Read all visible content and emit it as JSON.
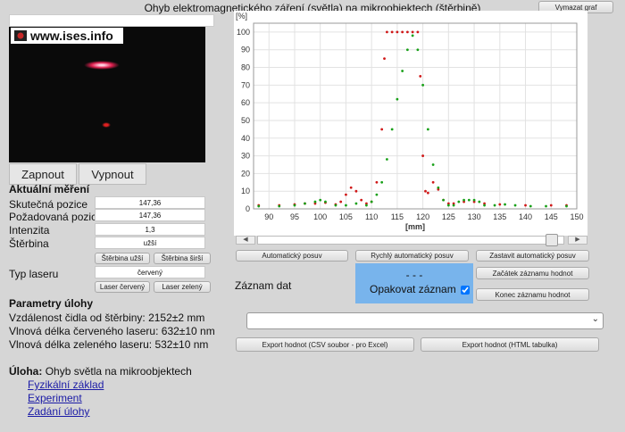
{
  "title": "Ohyb elektromagnetického záření (světla) na mikroobjektech (štěrbině)",
  "clear_graph": "Vymazat graf",
  "camera": {
    "logo": "www.ises.info"
  },
  "buttons": {
    "on": "Zapnout",
    "off": "Vypnout"
  },
  "measure": {
    "heading": "Aktuální měření",
    "actual_pos_label": "Skutečná pozice",
    "actual_pos": "147,36",
    "target_pos_label": "Požadovaná pozice",
    "target_pos": "147,36",
    "intensity_label": "Intenzita",
    "intensity": "1,3",
    "slit_label": "Štěrbina",
    "slit": "užší",
    "slit_narrower": "Štěrbina užší",
    "slit_wider": "Štěrbina širší",
    "laser_type_label": "Typ laseru",
    "laser_type": "červený",
    "laser_red": "Laser červený",
    "laser_green": "Laser zelený"
  },
  "params": {
    "heading": "Parametry úlohy",
    "distance": "Vzdálenost čidla od štěrbiny: 2152±2 mm",
    "red_wavelength": "Vlnová délka červeného laseru: 632±10 nm",
    "green_wavelength": "Vlnová délka zeleného laseru: 532±10 nm"
  },
  "task": {
    "label": "Úloha:",
    "name": "Ohyb světla na mikroobjektech",
    "links": [
      "Fyzikální základ",
      "Experiment",
      "Zadání úlohy"
    ]
  },
  "controls": {
    "auto_move": "Automatický posuv",
    "fast_auto_move": "Rychlý automatický posuv",
    "stop_auto_move": "Zastavit automatický posuv",
    "record_label": "Záznam dat",
    "record_status": "- - -",
    "repeat_record": "Opakovat záznam",
    "start_record": "Začátek záznamu hodnot",
    "end_record": "Konec záznamu hodnot",
    "export_csv": "Export hodnot (CSV soubor - pro Excel)",
    "export_html": "Export hodnot (HTML tabulka)"
  },
  "chart_data": {
    "type": "scatter",
    "ylabel": "[%]",
    "xlabel": "[mm]",
    "xlim": [
      87,
      150
    ],
    "ylim": [
      0,
      105
    ],
    "xticks": [
      90,
      95,
      100,
      105,
      110,
      115,
      120,
      125,
      130,
      135,
      140,
      145,
      150
    ],
    "yticks": [
      0,
      10,
      20,
      30,
      40,
      50,
      60,
      70,
      80,
      90,
      100
    ],
    "grid": true,
    "series": [
      {
        "color": "#d01818",
        "points": [
          [
            88,
            2
          ],
          [
            92,
            2
          ],
          [
            95,
            2.5
          ],
          [
            97,
            3
          ],
          [
            99,
            3
          ],
          [
            101,
            3.5
          ],
          [
            103,
            2.5
          ],
          [
            104,
            4
          ],
          [
            105,
            8
          ],
          [
            106,
            12
          ],
          [
            107,
            10
          ],
          [
            108,
            5
          ],
          [
            109,
            3
          ],
          [
            110,
            4
          ],
          [
            111,
            15
          ],
          [
            112,
            45
          ],
          [
            112.5,
            85
          ],
          [
            113,
            100
          ],
          [
            114,
            100
          ],
          [
            115,
            100
          ],
          [
            116,
            100
          ],
          [
            117,
            100
          ],
          [
            118,
            100
          ],
          [
            119,
            100
          ],
          [
            119.5,
            75
          ],
          [
            120,
            30
          ],
          [
            120.5,
            10
          ],
          [
            121,
            9
          ],
          [
            122,
            15
          ],
          [
            123,
            11
          ],
          [
            124,
            5
          ],
          [
            125,
            3
          ],
          [
            126,
            3
          ],
          [
            128,
            4
          ],
          [
            130,
            4
          ],
          [
            132,
            3
          ],
          [
            135,
            2.5
          ],
          [
            140,
            2
          ],
          [
            145,
            2
          ],
          [
            148,
            2
          ]
        ]
      },
      {
        "color": "#18a018",
        "points": [
          [
            88,
            1.5
          ],
          [
            92,
            1.5
          ],
          [
            95,
            2
          ],
          [
            97,
            3
          ],
          [
            99,
            4
          ],
          [
            100,
            5
          ],
          [
            101,
            4
          ],
          [
            103,
            2
          ],
          [
            105,
            2
          ],
          [
            107,
            3
          ],
          [
            109,
            2
          ],
          [
            110,
            4
          ],
          [
            111,
            8
          ],
          [
            112,
            15
          ],
          [
            113,
            28
          ],
          [
            114,
            45
          ],
          [
            115,
            62
          ],
          [
            116,
            78
          ],
          [
            117,
            90
          ],
          [
            118,
            98
          ],
          [
            119,
            90
          ],
          [
            120,
            70
          ],
          [
            121,
            45
          ],
          [
            122,
            25
          ],
          [
            123,
            12
          ],
          [
            124,
            5
          ],
          [
            125,
            2
          ],
          [
            126,
            2
          ],
          [
            127,
            4
          ],
          [
            128,
            5
          ],
          [
            129,
            5
          ],
          [
            130,
            5
          ],
          [
            131,
            4
          ],
          [
            132,
            2
          ],
          [
            134,
            2
          ],
          [
            136,
            2.5
          ],
          [
            138,
            2
          ],
          [
            141,
            1.5
          ],
          [
            144,
            1.5
          ],
          [
            148,
            1.5
          ]
        ]
      }
    ]
  }
}
